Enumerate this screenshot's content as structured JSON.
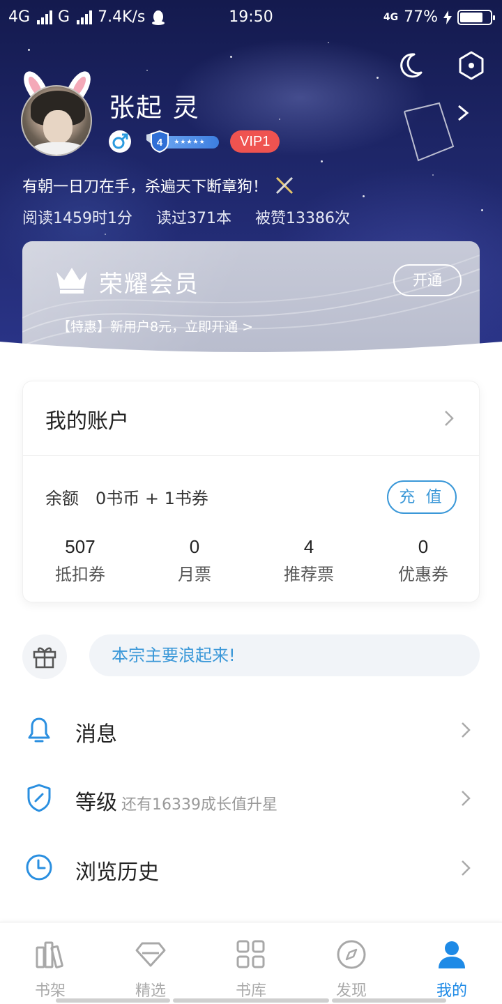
{
  "status_bar": {
    "network1": "4G",
    "network2": "G",
    "speed": "7.4K/s",
    "time": "19:50",
    "network_right": "4G",
    "battery": "77%",
    "battery_level": 0.77
  },
  "profile": {
    "name": "张起 灵",
    "level": "4",
    "stars": "★★★★★",
    "vip": "VIP1",
    "motto": "有朝一日刀在手，杀遍天下断章狗！",
    "stats": [
      "阅读1459时1分",
      "读过371本",
      "被赞13386次"
    ]
  },
  "vip_card": {
    "title": "荣耀会员",
    "button": "开通",
    "promo": "【特惠】新用户8元，立即开通 >"
  },
  "account": {
    "title": "我的账户",
    "balance_label": "余额",
    "balance_value": "0书币 + 1书券",
    "recharge": "充 值",
    "tickets": [
      {
        "value": "507",
        "label": "抵扣券"
      },
      {
        "value": "0",
        "label": "月票"
      },
      {
        "value": "4",
        "label": "推荐票"
      },
      {
        "value": "0",
        "label": "优惠券"
      }
    ]
  },
  "gift": {
    "text": "本宗主要浪起来!"
  },
  "menu": [
    {
      "label": "消息",
      "sub": ""
    },
    {
      "label": "等级",
      "sub": "还有16339成长值升星"
    },
    {
      "label": "浏览历史",
      "sub": ""
    }
  ],
  "nav": [
    {
      "label": "书架",
      "icon": "bookshelf-icon"
    },
    {
      "label": "精选",
      "icon": "diamond-icon"
    },
    {
      "label": "书库",
      "icon": "grid-icon"
    },
    {
      "label": "发现",
      "icon": "compass-icon"
    },
    {
      "label": "我的",
      "icon": "user-icon"
    }
  ],
  "colors": {
    "accent": "#1e8ae6",
    "recharge": "#3b98d8",
    "vip_badge": "#ef5350",
    "header_bg": "#1d2566"
  }
}
